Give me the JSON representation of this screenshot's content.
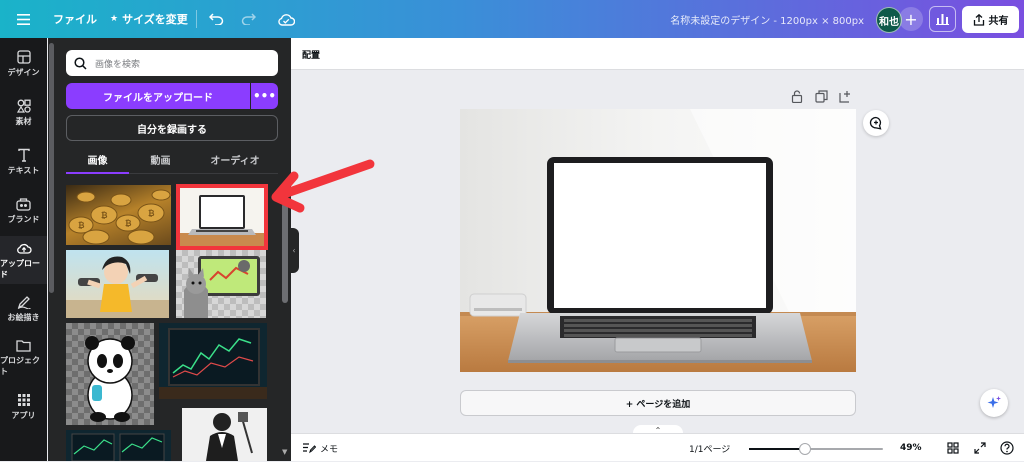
{
  "topbar": {
    "menu_icon": "hamburger-icon",
    "file_label": "ファイル",
    "resize_label": "サイズを変更",
    "resize_icon": "star-icon",
    "undo_icon": "undo-icon",
    "redo_icon": "redo-icon",
    "cloud_icon": "cloud-icon",
    "doc_title": "名称未設定のデザイン - 1200px × 800px",
    "avatar_initials": "和也",
    "share_label": "共有"
  },
  "rail": {
    "items": [
      {
        "label": "デザイン",
        "icon": "layout-icon"
      },
      {
        "label": "素材",
        "icon": "shapes-icon"
      },
      {
        "label": "テキスト",
        "icon": "text-icon"
      },
      {
        "label": "ブランド",
        "icon": "brand-icon"
      },
      {
        "label": "アップロード",
        "icon": "cloud-upload-icon"
      },
      {
        "label": "お絵描き",
        "icon": "draw-icon"
      },
      {
        "label": "プロジェクト",
        "icon": "folder-icon"
      },
      {
        "label": "アプリ",
        "icon": "apps-icon"
      }
    ],
    "active_index": 4
  },
  "panel": {
    "search_placeholder": "画像を検索",
    "upload_label": "ファイルをアップロード",
    "more_label": "•••",
    "record_label": "自分を録画する",
    "tabs": [
      "画像",
      "動画",
      "オーディオ"
    ],
    "active_tab": 0
  },
  "arrange": {
    "label": "配置"
  },
  "canvas": {
    "add_page_label": "+ ページを追加"
  },
  "bottombar": {
    "notes_label": "メモ",
    "page_indicator": "1/1ページ",
    "zoom_level": "49%",
    "zoom_fraction": 0.42
  },
  "colors": {
    "accent": "#8b3dff",
    "highlight": "#f2353c"
  }
}
